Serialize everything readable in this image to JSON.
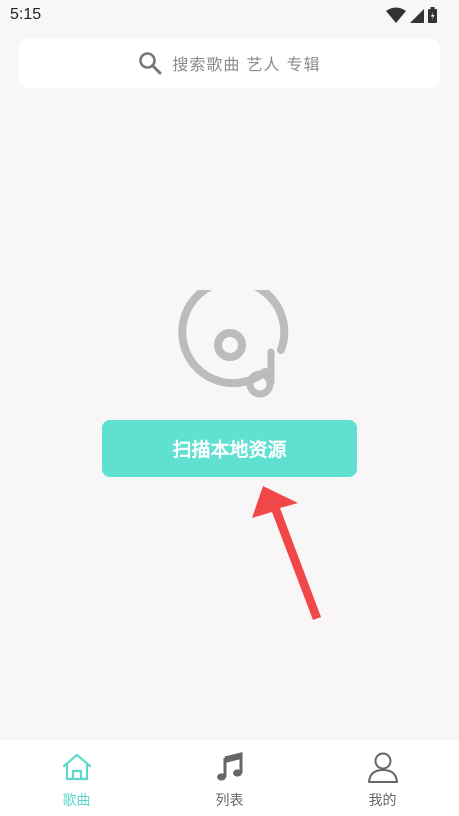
{
  "status_bar": {
    "time": "5:15"
  },
  "search": {
    "placeholder": "搜索歌曲 艺人 专辑"
  },
  "main": {
    "scan_button_label": "扫描本地资源"
  },
  "bottom_nav": {
    "items": [
      {
        "label": "歌曲",
        "icon": "home-icon",
        "active": true
      },
      {
        "label": "列表",
        "icon": "music-note-icon",
        "active": false
      },
      {
        "label": "我的",
        "icon": "user-icon",
        "active": false
      }
    ]
  },
  "colors": {
    "accent": "#5fe0d1",
    "arrow": "#f04848",
    "background": "#f8f6f7"
  }
}
